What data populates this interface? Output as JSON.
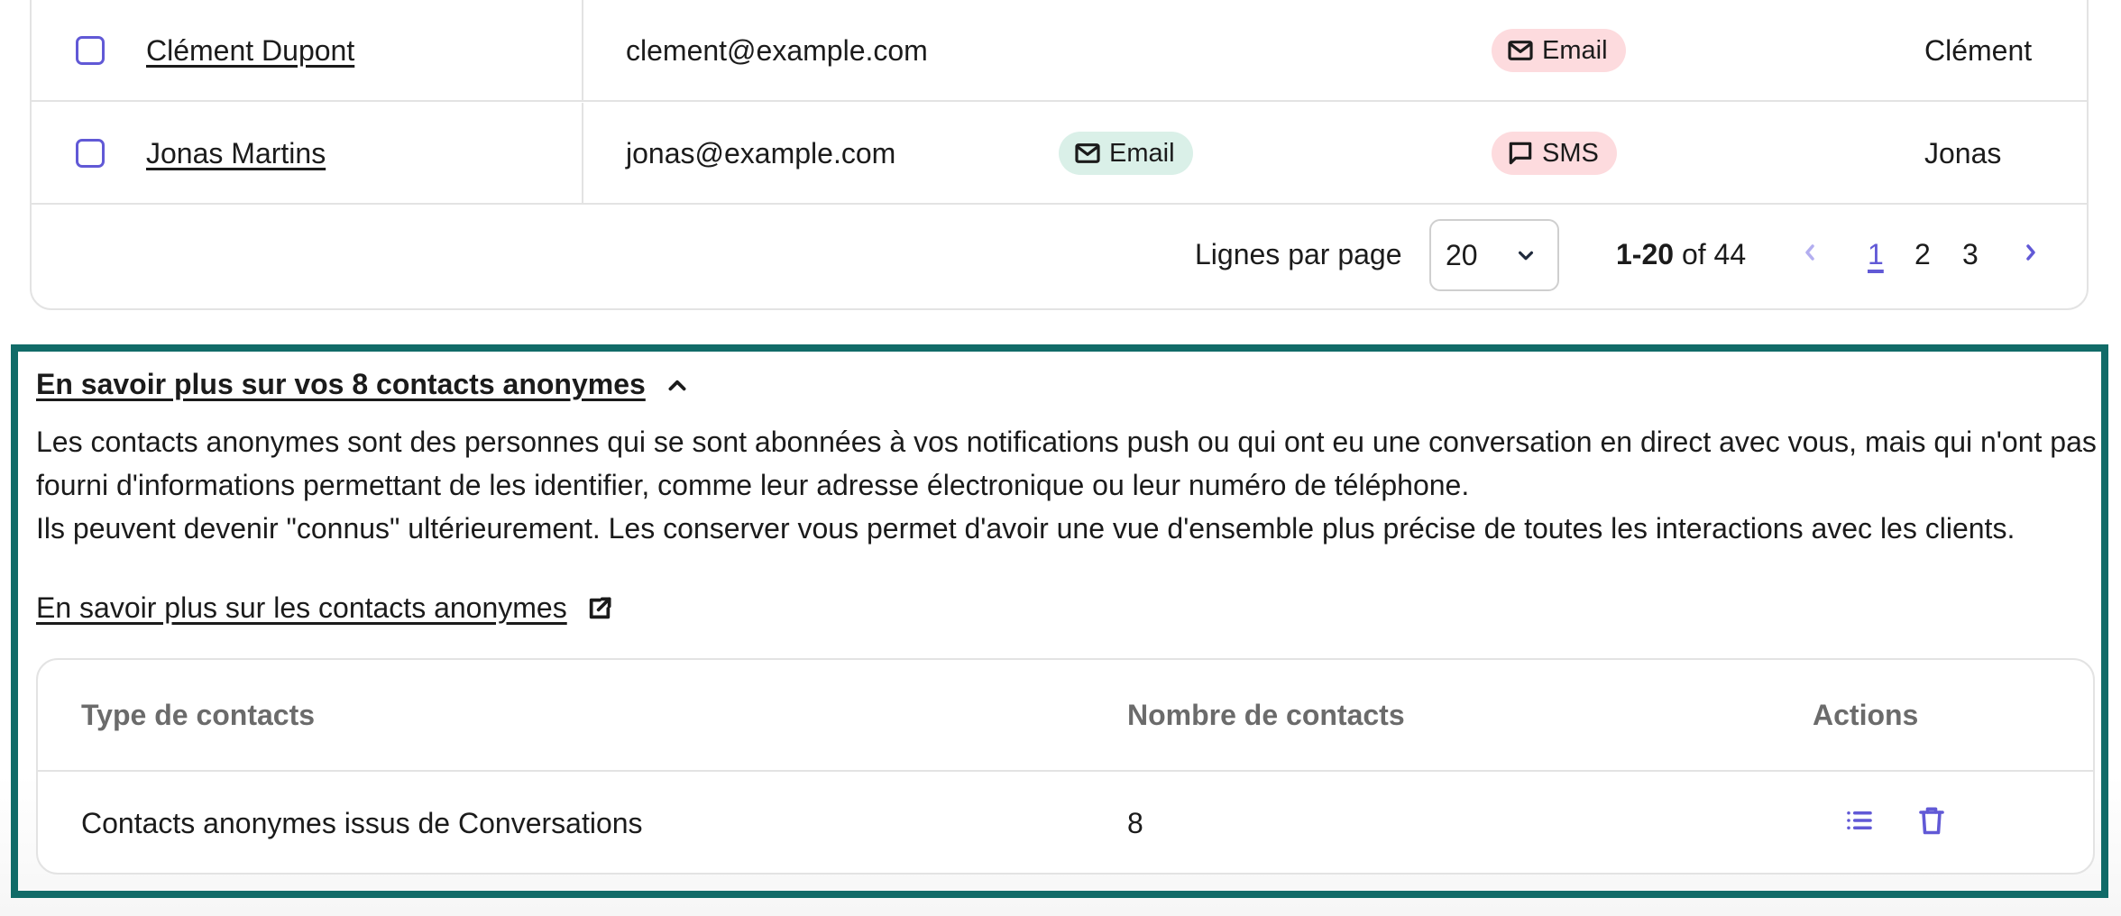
{
  "contacts_table": {
    "rows": [
      {
        "name": "Clément Dupont",
        "email": "clement@example.com",
        "channel_1": null,
        "channel_2": {
          "label": "Email",
          "icon": "mail-icon",
          "variant": "pink"
        },
        "first_name": "Clément"
      },
      {
        "name": "Jonas Martins",
        "email": "jonas@example.com",
        "channel_1": {
          "label": "Email",
          "icon": "mail-icon",
          "variant": "green"
        },
        "channel_2": {
          "label": "SMS",
          "icon": "chat-bubble-icon",
          "variant": "pink"
        },
        "first_name": "Jonas"
      }
    ],
    "pagination": {
      "rows_per_page_label": "Lignes par page",
      "rows_per_page_value": "20",
      "range_bold": "1-20",
      "range_rest": " of 44",
      "pages": [
        "1",
        "2",
        "3"
      ],
      "current_page": "1"
    }
  },
  "anonymous": {
    "toggle_label": "En savoir plus sur vos 8 contacts anonymes",
    "description_line1": "Les contacts anonymes sont des personnes qui se sont abonnées à vos notifications push ou qui ont eu une conversation en direct avec vous, mais qui n'ont pas fourni d'informations permettant de les identifier, comme leur adresse électronique ou leur numéro de téléphone.",
    "description_line2": "Ils peuvent devenir \"connus\" ultérieurement. Les conserver vous permet d'avoir une vue d'ensemble plus précise de toutes les interactions avec les clients.",
    "learn_more_link": "En savoir plus sur les contacts anonymes",
    "table": {
      "headers": [
        "Type de contacts",
        "Nombre de contacts",
        "Actions"
      ],
      "rows": [
        {
          "type": "Contacts anonymes issus de Conversations",
          "count": "8"
        }
      ]
    }
  },
  "colors": {
    "accent": "#6159d6",
    "focus_border": "#116b68",
    "badge_green": "#daf0e8",
    "badge_pink": "#fddbde",
    "border": "#e3e3e3",
    "header_text": "#6b6b6b"
  }
}
